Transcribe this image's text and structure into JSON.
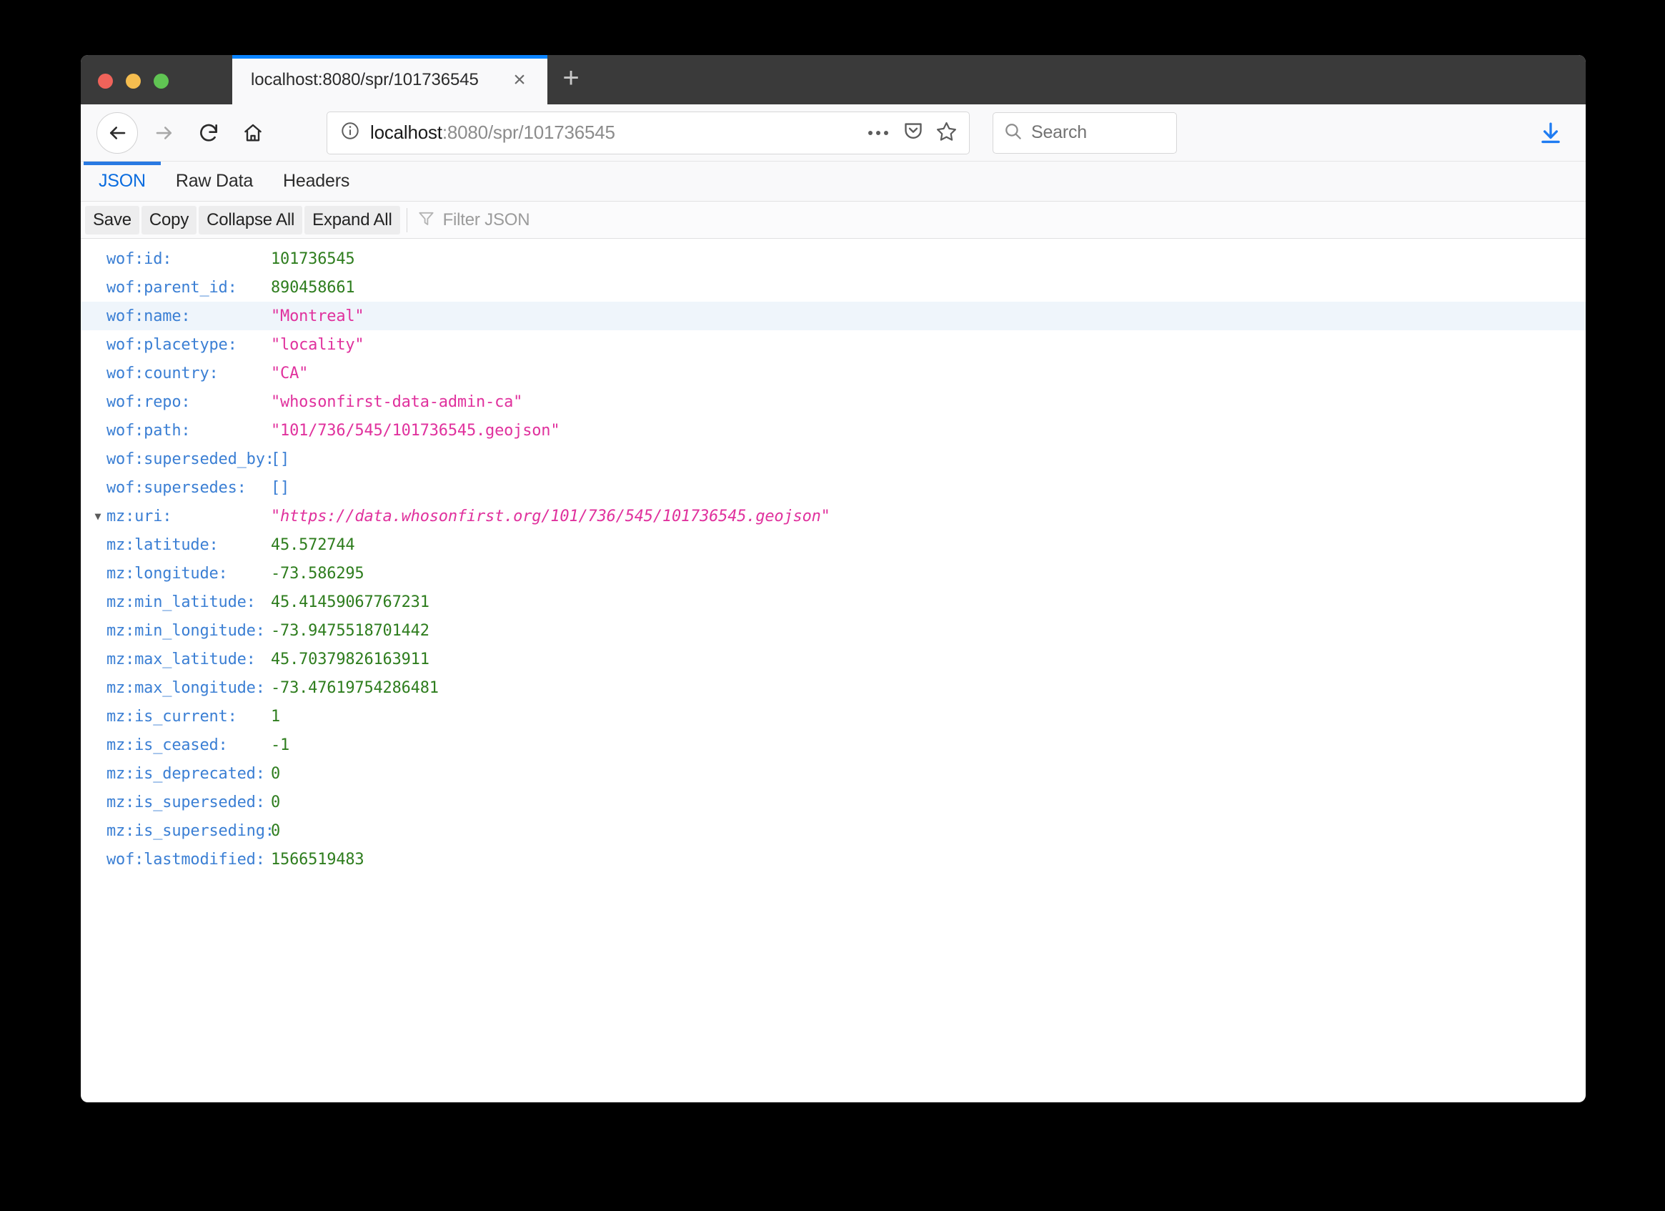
{
  "window": {
    "traffic_lights": [
      "close",
      "minimize",
      "maximize"
    ]
  },
  "tab": {
    "title": "localhost:8080/spr/101736545",
    "close_label": "×",
    "newtab_label": "+"
  },
  "navbar": {
    "back_icon": "back-arrow-icon",
    "forward_icon": "forward-arrow-icon",
    "reload_icon": "reload-icon",
    "home_icon": "home-icon",
    "url_host": "localhost",
    "url_rest": ":8080/spr/101736545",
    "page_actions_icon": "ellipsis-icon",
    "pocket_icon": "pocket-shield-icon",
    "bookmark_icon": "star-icon",
    "search_placeholder": "Search",
    "search_icon": "search-icon",
    "download_icon": "download-arrow-icon"
  },
  "viewer": {
    "tabs": [
      {
        "label": "JSON",
        "active": true
      },
      {
        "label": "Raw Data",
        "active": false
      },
      {
        "label": "Headers",
        "active": false
      }
    ],
    "toolbar": {
      "save_label": "Save",
      "copy_label": "Copy",
      "collapse_label": "Collapse All",
      "expand_label": "Expand All",
      "filter_icon": "filter-funnel-icon",
      "filter_placeholder": "Filter JSON"
    },
    "rows": [
      {
        "key": "wof:id:",
        "value": "101736545",
        "type": "num",
        "twisty": false,
        "highlight": false
      },
      {
        "key": "wof:parent_id:",
        "value": "890458661",
        "type": "num",
        "twisty": false,
        "highlight": false
      },
      {
        "key": "wof:name:",
        "value": "\"Montreal\"",
        "type": "str",
        "twisty": false,
        "highlight": true
      },
      {
        "key": "wof:placetype:",
        "value": "\"locality\"",
        "type": "str",
        "twisty": false,
        "highlight": false
      },
      {
        "key": "wof:country:",
        "value": "\"CA\"",
        "type": "str",
        "twisty": false,
        "highlight": false
      },
      {
        "key": "wof:repo:",
        "value": "\"whosonfirst-data-admin-ca\"",
        "type": "str",
        "twisty": false,
        "highlight": false
      },
      {
        "key": "wof:path:",
        "value": "\"101/736/545/101736545.geojson\"",
        "type": "str",
        "twisty": false,
        "highlight": false
      },
      {
        "key": "wof:superseded_by:",
        "value": "[]",
        "type": "arr",
        "twisty": false,
        "highlight": false
      },
      {
        "key": "wof:supersedes:",
        "value": "[]",
        "type": "arr",
        "twisty": false,
        "highlight": false
      },
      {
        "key": "mz:uri:",
        "value": "\"https://data.whosonfirst.org/101/736/545/101736545.geojson\"",
        "type": "link",
        "twisty": true,
        "highlight": false
      },
      {
        "key": "mz:latitude:",
        "value": "45.572744",
        "type": "num",
        "twisty": false,
        "highlight": false
      },
      {
        "key": "mz:longitude:",
        "value": "-73.586295",
        "type": "num",
        "twisty": false,
        "highlight": false
      },
      {
        "key": "mz:min_latitude:",
        "value": "45.41459067767231",
        "type": "num",
        "twisty": false,
        "highlight": false
      },
      {
        "key": "mz:min_longitude:",
        "value": "-73.9475518701442",
        "type": "num",
        "twisty": false,
        "highlight": false
      },
      {
        "key": "mz:max_latitude:",
        "value": "45.70379826163911",
        "type": "num",
        "twisty": false,
        "highlight": false
      },
      {
        "key": "mz:max_longitude:",
        "value": "-73.47619754286481",
        "type": "num",
        "twisty": false,
        "highlight": false
      },
      {
        "key": "mz:is_current:",
        "value": "1",
        "type": "num",
        "twisty": false,
        "highlight": false
      },
      {
        "key": "mz:is_ceased:",
        "value": "-1",
        "type": "num",
        "twisty": false,
        "highlight": false
      },
      {
        "key": "mz:is_deprecated:",
        "value": "0",
        "type": "num",
        "twisty": false,
        "highlight": false
      },
      {
        "key": "mz:is_superseded:",
        "value": "0",
        "type": "num",
        "twisty": false,
        "highlight": false
      },
      {
        "key": "mz:is_superseding:",
        "value": "0",
        "type": "num",
        "twisty": false,
        "highlight": false
      },
      {
        "key": "wof:lastmodified:",
        "value": "1566519483",
        "type": "num",
        "twisty": false,
        "highlight": false
      }
    ]
  },
  "colors": {
    "accent_blue": "#0a84ff",
    "tab_active_blue": "#2a7ae2",
    "key_blue": "#3b7fd4",
    "number_green": "#2e7d1e",
    "string_magenta": "#e0319d",
    "chrome_dark": "#3a3a3a",
    "row_highlight": "#eff5fb"
  }
}
